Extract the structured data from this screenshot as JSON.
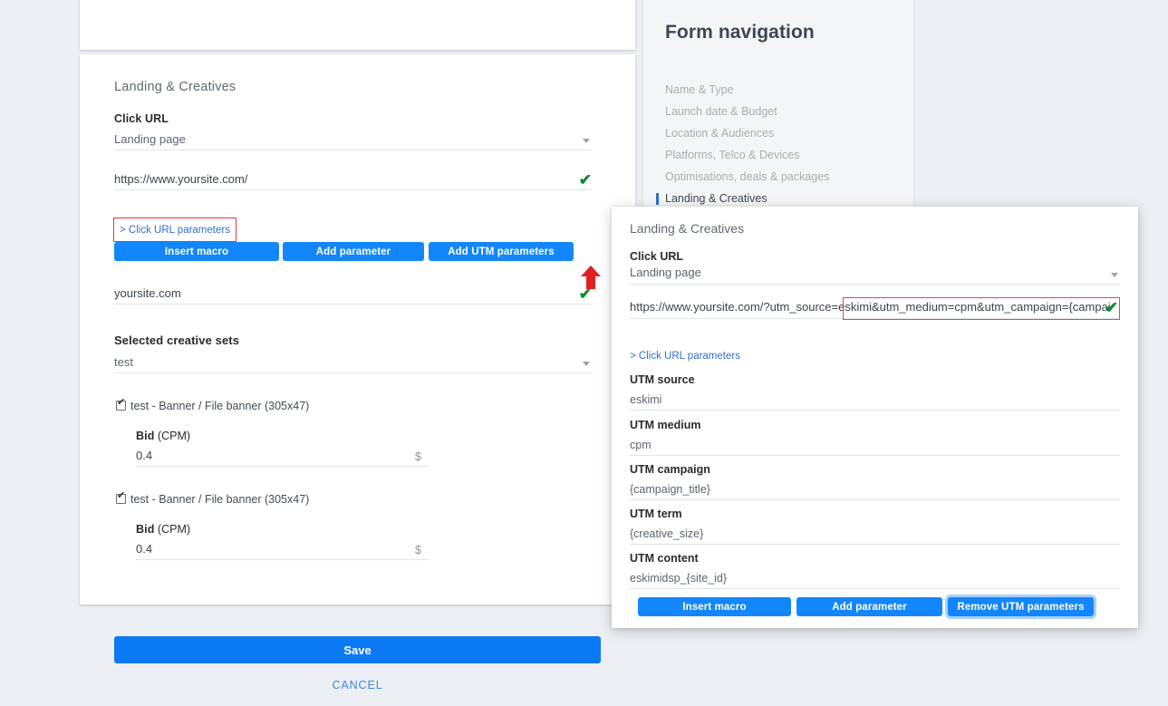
{
  "theme": {
    "page_background": "#eceff3",
    "card_background": "#ffffff",
    "accent_blue": "#1386fc",
    "save_blue": "#0b79f4",
    "link_blue": "#2f6fd0",
    "annotation_red": "#e23b3b",
    "valid_green": "#118a2e",
    "nav_card_background": "#f4f5f7"
  },
  "main_form": {
    "section_title": "Landing & Creatives",
    "click_url": {
      "label": "Click URL",
      "select_value": "Landing page",
      "select_caret_icon": "chevron-down-icon",
      "url_value": "https://www.yoursite.com/",
      "url_valid_icon": "green-check-icon"
    },
    "click_url_parameters_link": "> Click URL parameters",
    "buttons": {
      "insert_macro": "Insert macro",
      "add_parameter": "Add parameter",
      "add_utm_parameters": "Add UTM parameters"
    },
    "annotation_arrow_icon": "red-up-arrow-icon",
    "domain_field": {
      "value": "yoursite.com",
      "valid_icon": "green-check-icon"
    },
    "creative_sets": {
      "label": "Selected creative sets",
      "select_value": "test",
      "select_caret_icon": "chevron-down-icon",
      "items": [
        {
          "checked": true,
          "name": "test - Banner / File banner (305x47)",
          "bid_label_bold": "Bid",
          "bid_label_rest": " (CPM)",
          "bid_value": "0.4",
          "currency": "$",
          "edit_icon": "edit-square-icon",
          "preview_icon": "magnifier-icon"
        },
        {
          "checked": true,
          "name": "test - Banner / File banner (305x47)",
          "bid_label_bold": "Bid",
          "bid_label_rest": " (CPM)",
          "bid_value": "0.4",
          "currency": "$",
          "edit_icon": "edit-square-icon",
          "preview_icon": "magnifier-icon"
        }
      ]
    },
    "footer": {
      "save": "Save",
      "cancel": "CANCEL"
    }
  },
  "form_navigation": {
    "title": "Form navigation",
    "items": [
      {
        "label": "Name & Type",
        "active": false
      },
      {
        "label": "Launch date & Budget",
        "active": false
      },
      {
        "label": "Location & Audiences",
        "active": false
      },
      {
        "label": "Platforms, Telco & Devices",
        "active": false
      },
      {
        "label": "Optimisations, deals & packages",
        "active": false
      },
      {
        "label": "Landing & Creatives",
        "active": true
      }
    ]
  },
  "overlay_panel": {
    "title": "Landing & Creatives",
    "click_url": {
      "label": "Click URL",
      "select_value": "Landing page",
      "select_caret_icon": "chevron-down-icon",
      "url_value": "https://www.yoursite.com/?utm_source=eskimi&utm_medium=cpm&utm_campaign={campaign_title}&",
      "url_valid_icon": "green-check-icon"
    },
    "click_url_parameters_link": "> Click URL parameters",
    "utm_fields": [
      {
        "label": "UTM source",
        "value": "eskimi"
      },
      {
        "label": "UTM medium",
        "value": "cpm"
      },
      {
        "label": "UTM campaign",
        "value": "{campaign_title}"
      },
      {
        "label": "UTM term",
        "value": "{creative_size}"
      },
      {
        "label": "UTM content",
        "value": "eskimidsp_{site_id}"
      }
    ],
    "buttons": {
      "insert_macro": "Insert macro",
      "add_parameter": "Add parameter",
      "remove_utm_parameters": "Remove UTM parameters"
    }
  }
}
